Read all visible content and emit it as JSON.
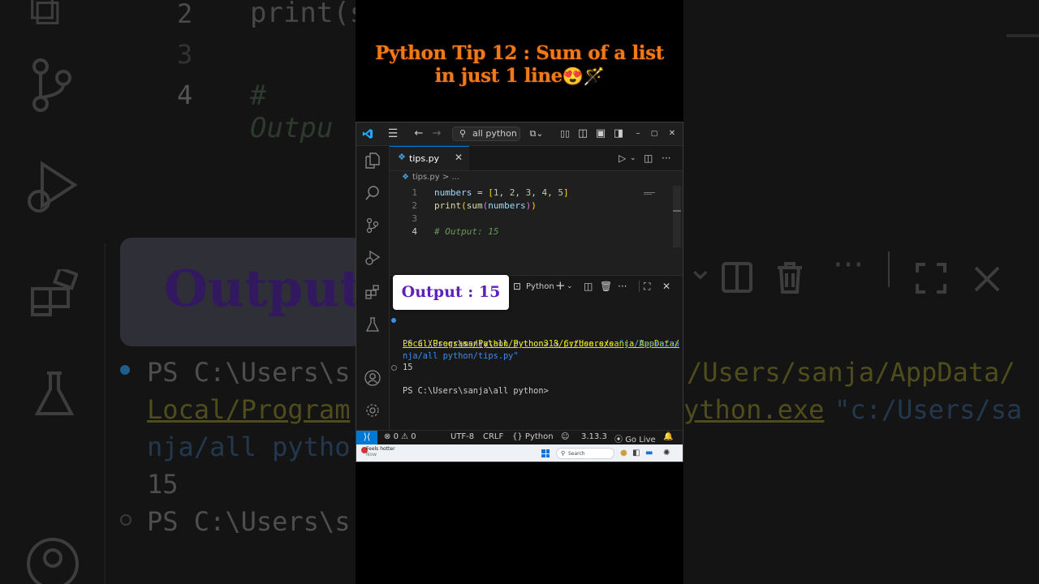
{
  "overlay": {
    "title_line1": "Python Tip 12 : Sum of a list",
    "title_line2": "in just 1 line",
    "title_emojis": "😍🪄",
    "output_badge": "Output : 15"
  },
  "background": {
    "ghost_line_nums": [
      "2",
      "3",
      "4"
    ],
    "ghost_code_print": "print(s",
    "ghost_code_comment": "# Outpu",
    "ghost_output": "Output",
    "ghost_term_1": "PS C:\\Users\\s",
    "ghost_term_2": "Local/Program",
    "ghost_term_3": "nja/all pytho",
    "ghost_term_4": "15",
    "ghost_term_5": "PS C:\\Users\\s",
    "ghost_right_1": "/Users/sanja/AppData/",
    "ghost_right_2": "ython.exe",
    "ghost_right_2b": "\"c:/Users/sa"
  },
  "titlebar": {
    "search_text": "all python",
    "icons": [
      "vscode-logo",
      "menu",
      "back",
      "forward",
      "copilot",
      "layout-toggles",
      "minimize",
      "maximize",
      "close"
    ]
  },
  "editor": {
    "tab_label": "tips.py",
    "breadcrumb_file": "tips.py",
    "breadcrumb_sep": ">",
    "breadcrumb_rest": "...",
    "lines": [
      {
        "num": "1",
        "text": "numbers = [1, 2, 3, 4, 5]"
      },
      {
        "num": "2",
        "text": "print(sum(numbers))"
      },
      {
        "num": "3",
        "text": ""
      },
      {
        "num": "4",
        "text": "# Output: 15"
      }
    ]
  },
  "panel": {
    "terminal_name": "Python",
    "lines": [
      {
        "prompt": "PS C:\\Users\\sanja\\all python> & ",
        "path": "C:/Users/sanja/AppData/"
      },
      {
        "path": "Local/Programs/Python/Python313/python.exe",
        "arg": " \"c:/Users/sa"
      },
      {
        "arg": "nja/all python/tips.py\""
      },
      {
        "text": "15"
      },
      {
        "prompt": "PS C:\\Users\\sanja\\all python> "
      }
    ]
  },
  "status_bar": {
    "errors": "0",
    "warnings": "0",
    "encoding": "UTF-8",
    "eol": "CRLF",
    "language": "Python",
    "version": "3.13.3",
    "go_live": "Go Live"
  },
  "taskbar": {
    "weather_title": "Feels hotter",
    "weather_sub": "Now",
    "search_placeholder": "Search"
  },
  "colors": {
    "title_orange": "#f07a18",
    "badge_purple": "#5d22b8",
    "accent_blue": "#0078d4",
    "terminal_path_yellow": "#e5e510",
    "terminal_string_blue": "#3b8eea"
  }
}
